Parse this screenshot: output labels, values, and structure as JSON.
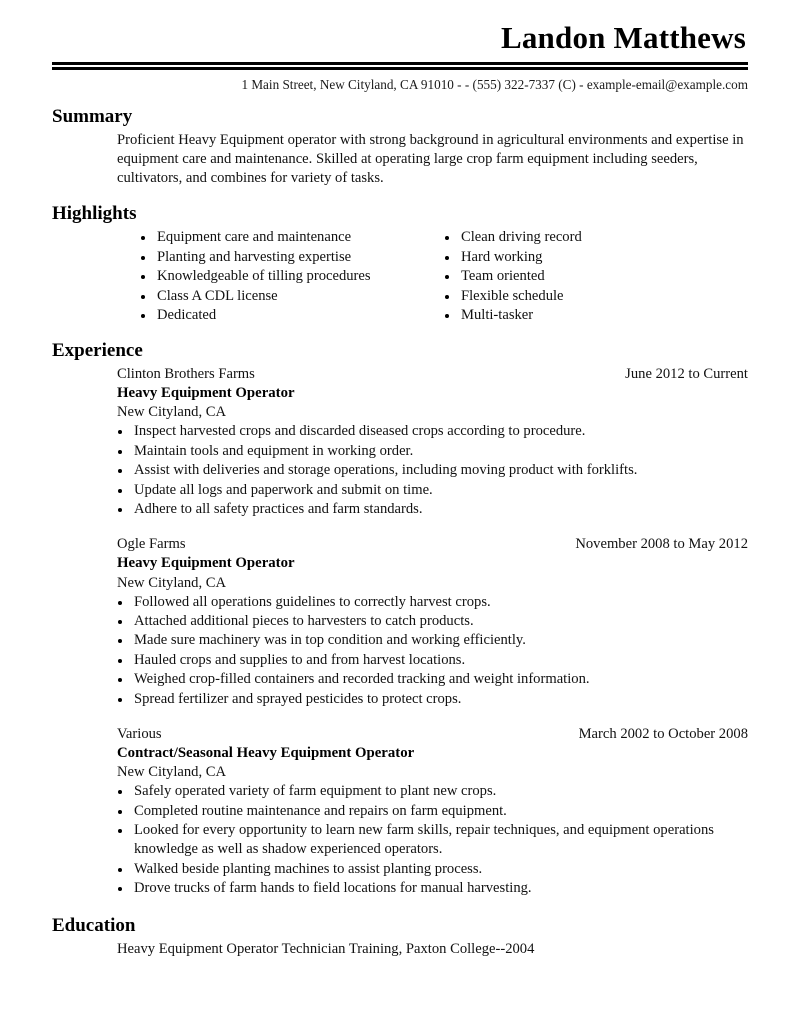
{
  "header": {
    "name": "Landon Matthews",
    "contact": "1 Main Street, New Cityland, CA 91010 - - (555) 322-7337 (C) - example-email@example.com"
  },
  "summary": {
    "title": "Summary",
    "text": "Proficient Heavy Equipment operator with strong background in agricultural environments and expertise in equipment care and maintenance. Skilled at operating large crop farm equipment including seeders, cultivators, and combines for variety of tasks."
  },
  "highlights": {
    "title": "Highlights",
    "column_left": [
      "Equipment care and maintenance",
      "Planting and harvesting expertise",
      "Knowledgeable of tilling procedures",
      "Class A CDL license",
      "Dedicated"
    ],
    "column_right": [
      "Clean driving record",
      "Hard working",
      "Team oriented",
      "Flexible schedule",
      "Multi-tasker"
    ]
  },
  "experience": {
    "title": "Experience",
    "jobs": [
      {
        "company": "Clinton Brothers Farms",
        "dates": "June 2012 to Current",
        "job_title": "Heavy Equipment Operator",
        "location": "New Cityland, CA",
        "bullets": [
          "Inspect harvested crops and discarded diseased crops according to procedure.",
          "Maintain tools and equipment in working order.",
          "Assist with deliveries and storage operations, including moving product with forklifts.",
          "Update all logs and paperwork and submit on time.",
          "Adhere to all safety practices and farm standards."
        ]
      },
      {
        "company": "Ogle Farms",
        "dates": "November 2008 to May 2012",
        "job_title": "Heavy Equipment Operator",
        "location": "New Cityland, CA",
        "bullets": [
          "Followed all operations guidelines to correctly harvest crops.",
          "Attached additional pieces to harvesters to catch products.",
          "Made sure machinery was in top condition and working efficiently.",
          "Hauled crops and supplies to and from harvest locations.",
          "Weighed crop-filled containers and recorded tracking and weight information.",
          "Spread fertilizer and sprayed pesticides to protect crops."
        ]
      },
      {
        "company": "Various",
        "dates": "March 2002 to October 2008",
        "job_title": "Contract/Seasonal Heavy Equipment Operator",
        "location": "New Cityland, CA",
        "bullets": [
          "Safely operated variety of farm equipment to plant new crops.",
          "Completed routine maintenance and repairs on farm equipment.",
          "Looked for every opportunity to learn new farm skills, repair techniques, and equipment operations knowledge as well as shadow experienced operators.",
          "Walked beside planting machines to assist planting process.",
          "Drove trucks of farm hands to field locations for manual harvesting."
        ]
      }
    ]
  },
  "education": {
    "title": "Education",
    "entry": "Heavy Equipment Operator Technician Training, Paxton College--2004"
  }
}
